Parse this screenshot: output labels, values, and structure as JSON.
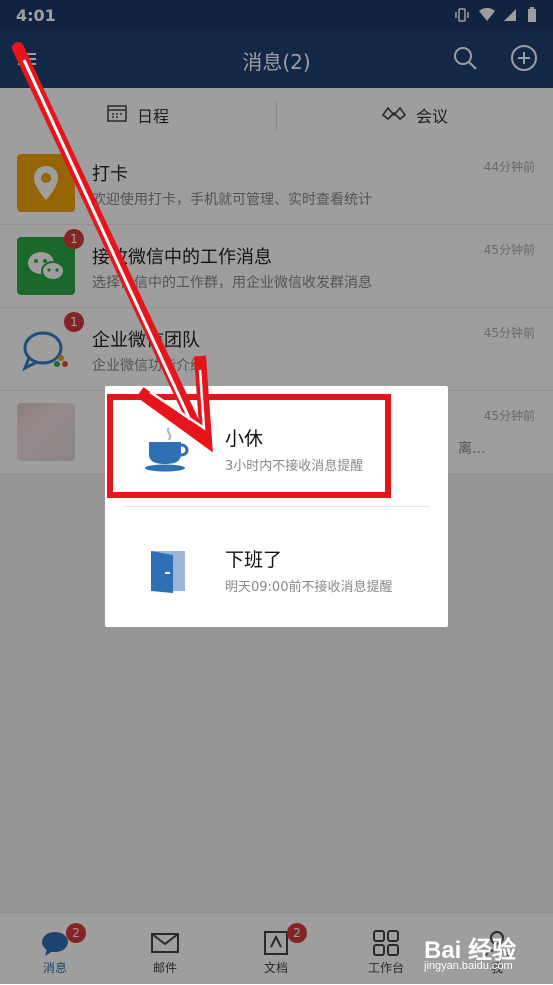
{
  "status": {
    "time": "4:01"
  },
  "appbar": {
    "title": "消息(2)"
  },
  "tabs": {
    "schedule": "日程",
    "meeting": "会议"
  },
  "conversations": [
    {
      "name": "打卡",
      "preview": "欢迎使用打卡，手机就可管理、实时查看统计",
      "time": "44分钟前",
      "badge": ""
    },
    {
      "name": "接收微信中的工作消息",
      "preview": "选择微信中的工作群，用企业微信收发群消息",
      "time": "45分钟前",
      "badge": "1"
    },
    {
      "name": "企业微信团队",
      "preview": "企业微信功能介绍",
      "time": "45分钟前",
      "badge": "1"
    },
    {
      "name": "",
      "preview": "离...",
      "time": "45分钟前",
      "badge": ""
    }
  ],
  "dialog": {
    "options": [
      {
        "title": "小休",
        "subtitle": "3小时内不接收消息提醒",
        "icon": "coffee-cup-icon"
      },
      {
        "title": "下班了",
        "subtitle": "明天09:00前不接收消息提醒",
        "icon": "door-icon"
      }
    ]
  },
  "bottomnav": [
    {
      "label": "消息",
      "badge": "2",
      "icon": "message-icon"
    },
    {
      "label": "邮件",
      "badge": "",
      "icon": "mail-icon"
    },
    {
      "label": "文档",
      "badge": "2",
      "icon": "document-icon"
    },
    {
      "label": "工作台",
      "badge": "",
      "icon": "grid-icon"
    },
    {
      "label": "我",
      "badge": "",
      "icon": "profile-icon"
    }
  ],
  "watermark": {
    "brand": "Bai 经验",
    "url": "jingyan.baidu.com"
  },
  "colors": {
    "header": "#1e4271",
    "accent": "#2f6fb6",
    "highlight": "#e8141b"
  }
}
